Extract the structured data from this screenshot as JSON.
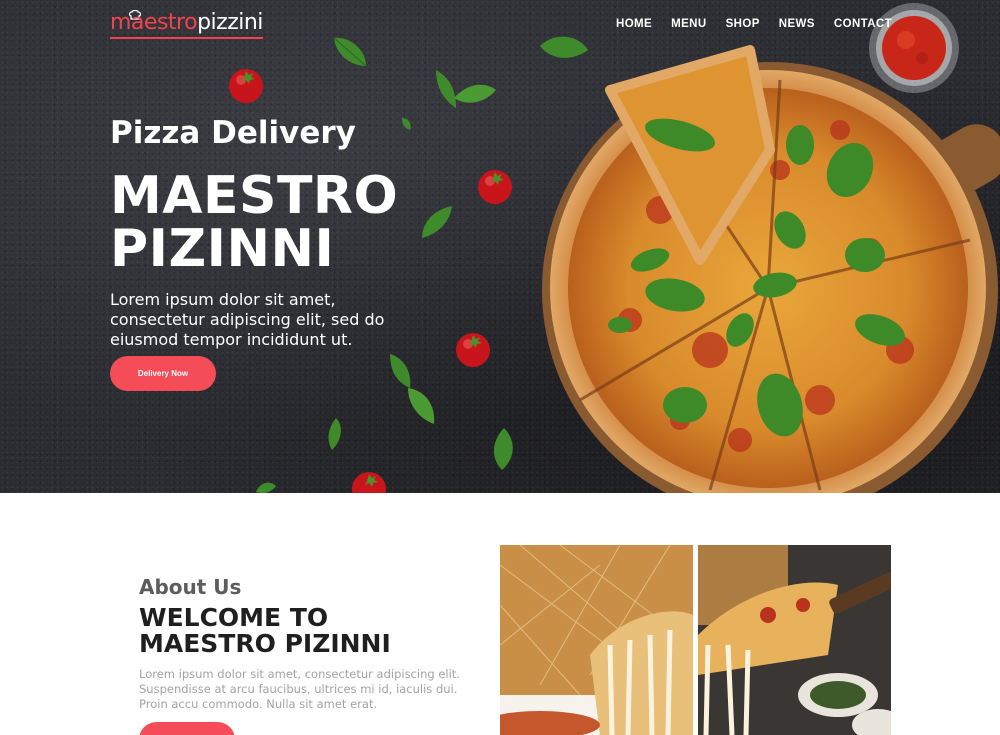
{
  "brand": {
    "name_part1": "maestro",
    "name_part2": "pizzini",
    "accent_color": "#f0434f",
    "icon": "chef-hat-icon"
  },
  "nav": {
    "items": [
      "HOME",
      "MENU",
      "SHOP",
      "NEWS",
      "CONTACT"
    ]
  },
  "hero": {
    "subtitle": "Pizza Delivery",
    "title_line1": "MAESTRO",
    "title_line2": "PIZINNI",
    "description": "Lorem ipsum dolor sit amet, consectetur adipiscing elit, sed do eiusmod tempor incididunt ut.",
    "button_label": "Delivery Now",
    "button_color": "#f54d58"
  },
  "about": {
    "label": "About Us",
    "title_line1": "WELCOME TO",
    "title_line2": "MAESTRO PIZINNI",
    "text": "Lorem ipsum dolor sit amet, consectetur adipiscing elit. Suspendisse at arcu faucibus, ultrices mi id, iaculis dui. Proin accu commodo. Nulla sit amet erat."
  }
}
